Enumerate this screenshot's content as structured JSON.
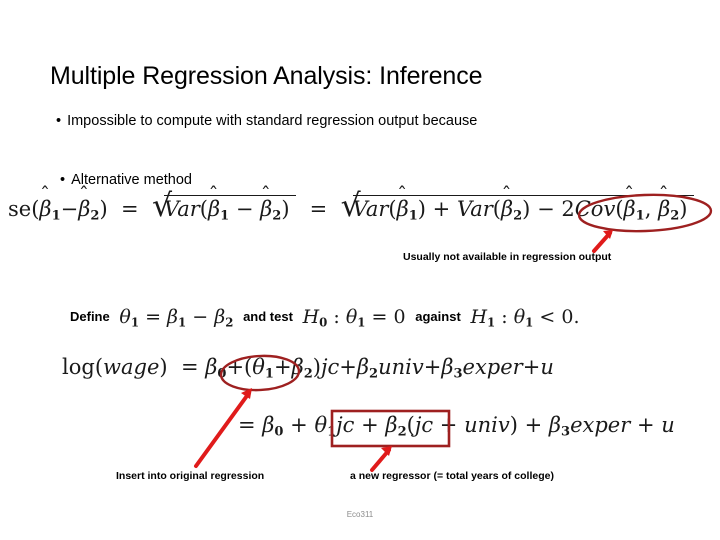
{
  "slide": {
    "title": "Multiple Regression Analysis: Inference",
    "bullet_marker": "•",
    "bullets": [
      {
        "text": "Impossible to compute with standard regression output because"
      },
      {
        "text": "Alternative method"
      }
    ],
    "footer": "Eco311"
  },
  "equations": {
    "se_formula": {
      "lhs_fn": "se",
      "beta": "β",
      "sub1": "1",
      "sub2": "2",
      "minus": "−",
      "plus": "+",
      "equals": "=",
      "var": "Var",
      "cov": "Cov",
      "two": "2",
      "comma": ",",
      "plain": "se(β̂1−β̂2) = √Var(β̂1 − β̂2) = √Var(β̂1) + Var(β̂2) − 2Cov(β̂1, β̂2)"
    },
    "define_line": {
      "define_word": "Define",
      "theta": "θ",
      "and_test_word": "and test",
      "against_word": "against",
      "h0": "H",
      "h1": "H",
      "zero": "0",
      "lt": "<",
      "period": ".",
      "plain": "Define θ1 = β1 − β2  and test  H0 : θ1 = 0  against  H1 : θ1 < 0."
    },
    "wage_line_1": {
      "log": "log",
      "wage": "wage",
      "beta": "β",
      "theta": "θ",
      "jc": "jc",
      "univ": "univ",
      "exper": "exper",
      "u": "u",
      "plain": "log(wage) = β0+(θ1+β2)jc+β2univ+β3exper+u"
    },
    "wage_line_2": {
      "plain": "= β0 + θ1jc + β2(jc + univ) + β3exper + u"
    }
  },
  "captions": {
    "cov": "Usually not available in regression output",
    "insert": "Insert into original regression",
    "regressor": "a new regressor (= total years of college)"
  },
  "colors": {
    "ink": "#000000",
    "math_ink": "#1a1a1a",
    "annotation_dark_red": "#9e2020",
    "annotation_bright_red": "#e01b1b",
    "footer_gray": "#8c8c8c",
    "background": "#ffffff"
  },
  "annotations": {
    "ellipse_cov": {
      "label": "ellipse-around-cov-term"
    },
    "ellipse_theta_beta": {
      "label": "ellipse-around-theta-plus-beta2"
    },
    "rect_jc_univ": {
      "label": "rectangle-around-jc-plus-univ"
    },
    "arrow_cov": {
      "label": "arrow-to-cov-term"
    },
    "arrow_insert": {
      "label": "arrow-to-theta-plus-beta2"
    },
    "arrow_regressor": {
      "label": "arrow-to-jc-plus-univ"
    }
  }
}
